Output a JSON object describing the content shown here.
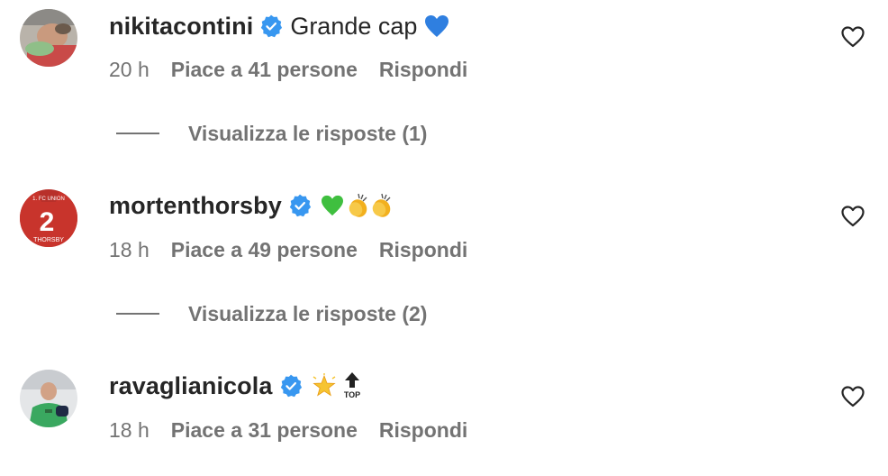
{
  "comments": [
    {
      "username": "nikitacontini",
      "verified": true,
      "text": "Grande cap",
      "emoji": "💙",
      "emoji_color": "#2f7fe0",
      "time": "20 h",
      "likes": "Piace a 41 persone",
      "reply": "Rispondi",
      "view_replies": "Visualizza le risposte (1)",
      "avatar_icon": "avatar-photo"
    },
    {
      "username": "mortenthorsby",
      "verified": true,
      "text": "",
      "emoji": "💚👏👏",
      "time": "18 h",
      "likes": "Piace a 49 persone",
      "reply": "Rispondi",
      "view_replies": "Visualizza le risposte (2)",
      "avatar_icon": "avatar-photo-jersey",
      "avatar_texts": [
        "1. FC UNION",
        "2",
        "THORSBY"
      ]
    },
    {
      "username": "ravaglianicola",
      "verified": true,
      "text": "",
      "emoji": "🌟🔝",
      "time": "18 h",
      "likes": "Piace a 31 persone",
      "reply": "Rispondi",
      "avatar_icon": "avatar-photo-goalkeeper"
    }
  ],
  "colors": {
    "verified_badge": "#3897f0",
    "meta_text": "#737373",
    "primary_text": "#262626"
  }
}
